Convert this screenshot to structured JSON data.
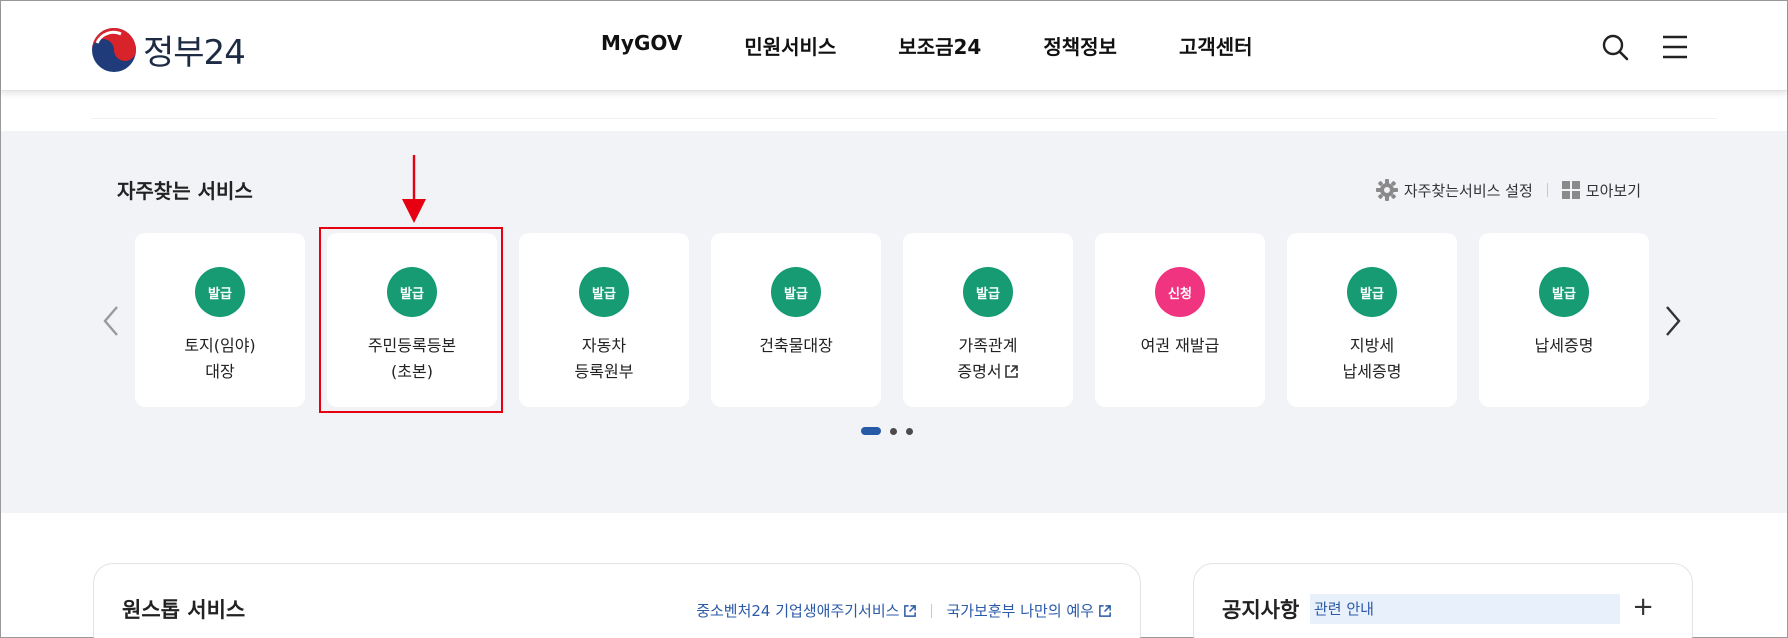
{
  "header": {
    "logo_text": "정부24",
    "nav": [
      "MyGOV",
      "민원서비스",
      "보조금24",
      "정책정보",
      "고객센터"
    ]
  },
  "frequent": {
    "title": "자주찾는 서비스",
    "settings_label": "자주찾는서비스 설정",
    "viewall_label": "모아보기",
    "cards": [
      {
        "badge": "발급",
        "label": "토지(임야)\n대장"
      },
      {
        "badge": "발급",
        "label": "주민등록등본\n(초본)"
      },
      {
        "badge": "발급",
        "label": "자동차\n등록원부"
      },
      {
        "badge": "발급",
        "label": "건축물대장"
      },
      {
        "badge": "발급",
        "label": "가족관계\n증명서"
      },
      {
        "badge": "신청",
        "label": "여권 재발급"
      },
      {
        "badge": "발급",
        "label": "지방세\n납세증명"
      },
      {
        "badge": "발급",
        "label": "납세증명"
      }
    ],
    "pager": {
      "current": 1,
      "total": 3
    }
  },
  "onestop": {
    "title": "원스톱 서비스",
    "links": [
      "중소벤처24 기업생애주기서비스",
      "국가보훈부 나만의 예우"
    ]
  },
  "notice": {
    "title": "공지사항",
    "tag": "관련 안내",
    "more": "+"
  },
  "colors": {
    "badge_issue": "#169b73",
    "badge_apply": "#f0347f",
    "highlight": "#e60012",
    "section_bg": "#f1f3f7",
    "link": "#2b5aa8"
  }
}
